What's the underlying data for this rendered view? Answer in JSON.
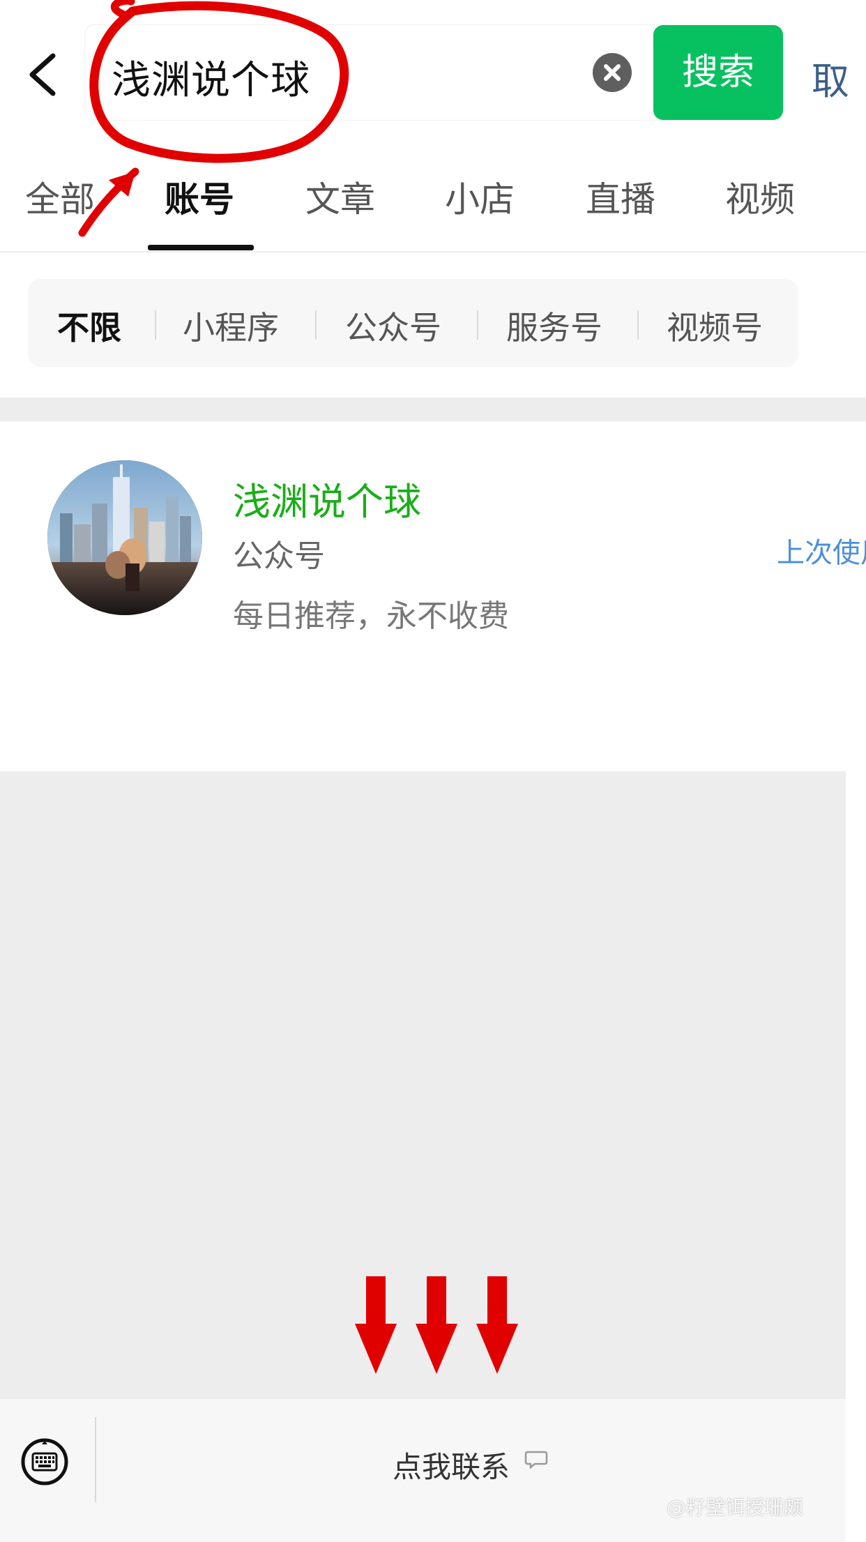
{
  "search": {
    "query": "浅渊说个球",
    "button_label": "搜索",
    "cancel_label": "取"
  },
  "tabs": [
    {
      "label": "全部"
    },
    {
      "label": "账号"
    },
    {
      "label": "文章"
    },
    {
      "label": "小店"
    },
    {
      "label": "直播"
    },
    {
      "label": "视频"
    }
  ],
  "filters": [
    {
      "label": "不限"
    },
    {
      "label": "小程序"
    },
    {
      "label": "公众号"
    },
    {
      "label": "服务号"
    },
    {
      "label": "视频号"
    }
  ],
  "result": {
    "title": "浅渊说个球",
    "type": "公众号",
    "description": "每日推荐，永不收费",
    "badge": "上次使用"
  },
  "bottom_bar": {
    "action_label": "点我联系"
  },
  "watermark": {
    "text": "@籽壁铒授珊颇"
  },
  "icons": {
    "back": "back-chevron-icon",
    "clear": "clear-search-icon",
    "keyboard": "keyboard-icon",
    "speech": "speech-bubble-icon"
  },
  "colors": {
    "accent": "#07c160",
    "title_green": "#1aad19",
    "link_blue": "#4a90d9",
    "annotation_red": "#e10000",
    "background_gray": "#ededed"
  }
}
